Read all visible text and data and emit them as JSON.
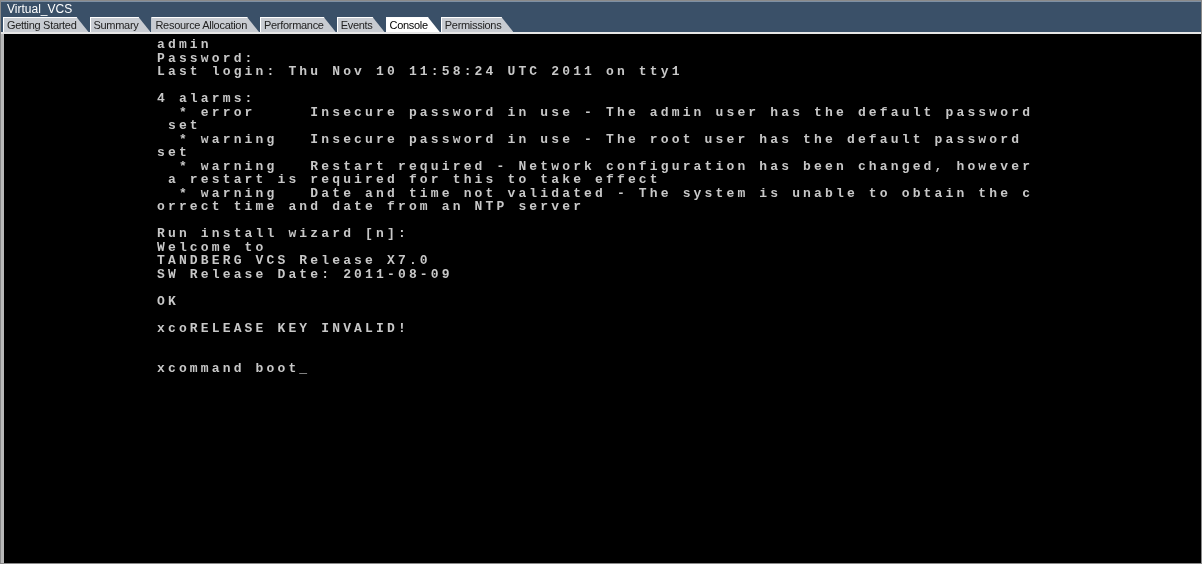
{
  "window": {
    "title": "Virtual_VCS"
  },
  "tabs": [
    {
      "label": "Getting Started",
      "selected": false
    },
    {
      "label": "Summary",
      "selected": false
    },
    {
      "label": "Resource Allocation",
      "selected": false
    },
    {
      "label": "Performance",
      "selected": false
    },
    {
      "label": "Events",
      "selected": false
    },
    {
      "label": "Console",
      "selected": true
    },
    {
      "label": "Permissions",
      "selected": false
    }
  ],
  "console": {
    "blocks": [
      {
        "lines": [
          "admin",
          "Password:",
          "Last login: Thu Nov 10 11:58:24 UTC 2011 on tty1"
        ]
      },
      {
        "lines": [
          "4 alarms:",
          "  * error     Insecure password in use - The admin user has the default password",
          " set",
          "  * warning   Insecure password in use - The root user has the default password",
          "set",
          "  * warning   Restart required - Network configuration has been changed, however",
          " a restart is required for this to take effect",
          "  * warning   Date and time not validated - The system is unable to obtain the c",
          "orrect time and date from an NTP server"
        ]
      },
      {
        "lines": [
          "Run install wizard [n]:",
          "Welcome to",
          "TANDBERG VCS Release X7.0",
          "SW Release Date: 2011-08-09"
        ]
      },
      {
        "lines": [
          "OK"
        ]
      },
      {
        "lines": [
          "xcoRELEASE KEY INVALID!"
        ]
      },
      {
        "lines": [
          "xcommand boot_"
        ]
      }
    ]
  }
}
